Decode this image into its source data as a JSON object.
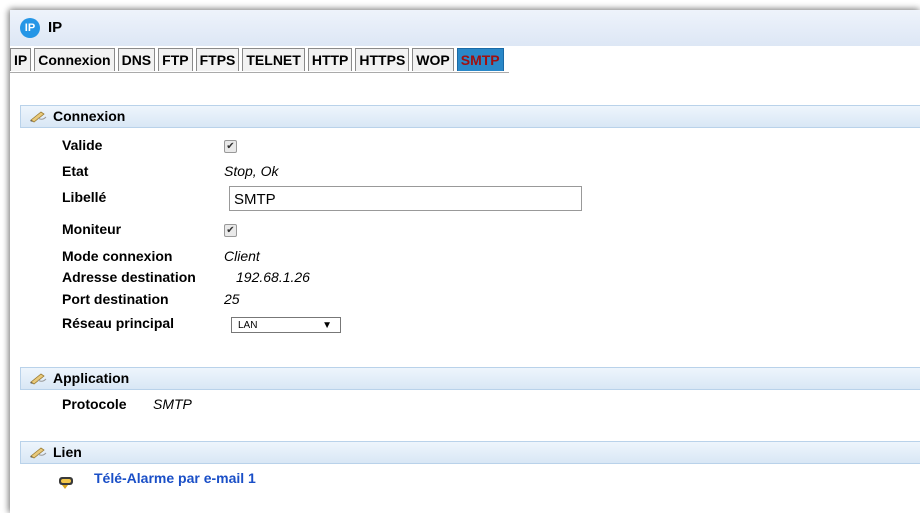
{
  "window": {
    "badge": "IP",
    "title": "IP"
  },
  "tabs": [
    {
      "label": "IP"
    },
    {
      "label": "Connexion"
    },
    {
      "label": "DNS"
    },
    {
      "label": "FTP"
    },
    {
      "label": "FTPS"
    },
    {
      "label": "TELNET"
    },
    {
      "label": "HTTP"
    },
    {
      "label": "HTTPS"
    },
    {
      "label": "WOP"
    },
    {
      "label": "SMTP",
      "active": true
    }
  ],
  "connexion": {
    "header": "Connexion",
    "valide_label": "Valide",
    "valide_checked": true,
    "etat_label": "Etat",
    "etat_value": "Stop, Ok",
    "libelle_label": "Libellé",
    "libelle_value": "SMTP",
    "moniteur_label": "Moniteur",
    "moniteur_checked": true,
    "mode_label": "Mode connexion",
    "mode_value": "Client",
    "adresse_label": "Adresse destination",
    "adresse_value": "192.68.1.26",
    "port_label": "Port destination",
    "port_value": "25",
    "reseau_label": "Réseau principal",
    "reseau_value": "LAN",
    "check_glyph": "✔",
    "select_arrow": "▼"
  },
  "application": {
    "header": "Application",
    "protocole_label": "Protocole",
    "protocole_value": "SMTP"
  },
  "lien": {
    "header": "Lien",
    "link_text": "Télé-Alarme par e-mail 1",
    "link_icon": "email-alarm-icon"
  },
  "colors": {
    "accent": "#2a88c8",
    "link": "#1a4fc7",
    "active_tab_text": "#a01010"
  }
}
